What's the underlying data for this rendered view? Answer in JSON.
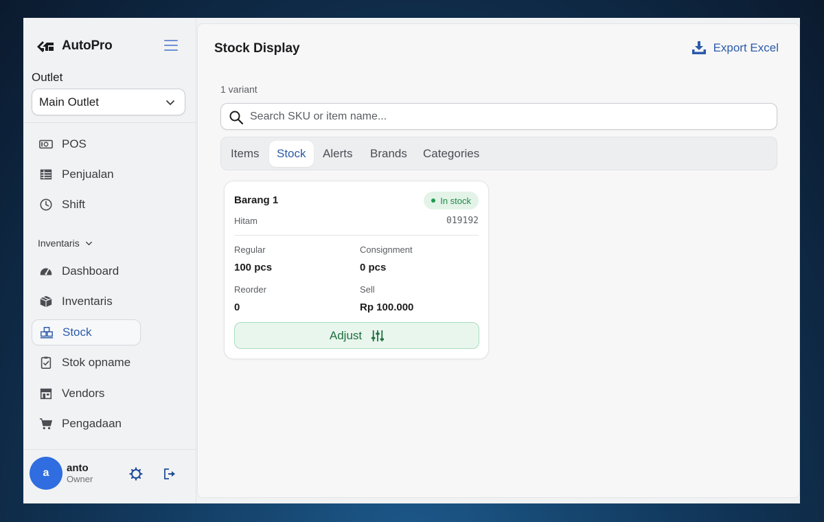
{
  "app": {
    "name": "AutoPro",
    "logo_icon": "autopro-logo-icon",
    "menu_icon": "hamburger-menu-icon"
  },
  "outlet": {
    "label": "Outlet",
    "selected": "Main Outlet"
  },
  "nav": {
    "top_items": [
      {
        "label": "POS",
        "icon": "cash-icon"
      },
      {
        "label": "Penjualan",
        "icon": "list-icon"
      },
      {
        "label": "Shift",
        "icon": "clock-icon"
      }
    ],
    "section_label": "Inventaris",
    "inventory_items": [
      {
        "label": "Dashboard",
        "icon": "gauge-icon"
      },
      {
        "label": "Inventaris",
        "icon": "box-icon"
      },
      {
        "label": "Stock",
        "icon": "stock-icon",
        "active": true
      },
      {
        "label": "Stok opname",
        "icon": "clipboard-check-icon"
      },
      {
        "label": "Vendors",
        "icon": "store-icon"
      },
      {
        "label": "Pengadaan",
        "icon": "cart-icon"
      }
    ]
  },
  "user": {
    "initial": "a",
    "name": "anto",
    "role": "Owner",
    "settings_icon": "gear-icon",
    "logout_icon": "logout-icon"
  },
  "page": {
    "title": "Stock Display",
    "export_label": "Export Excel",
    "variant_count": "1 variant",
    "search_placeholder": "Search SKU or item name..."
  },
  "tabs": [
    {
      "label": "Items"
    },
    {
      "label": "Stock",
      "active": true
    },
    {
      "label": "Alerts"
    },
    {
      "label": "Brands"
    },
    {
      "label": "Categories"
    }
  ],
  "card": {
    "name": "Barang 1",
    "status": "In stock",
    "variant": "Hitam",
    "sku": "019192",
    "regular_label": "Regular",
    "regular_value": "100 pcs",
    "consignment_label": "Consignment",
    "consignment_value": "0 pcs",
    "reorder_label": "Reorder",
    "reorder_value": "0",
    "sell_label": "Sell",
    "sell_value": "Rp 100.000",
    "adjust_label": "Adjust"
  },
  "colors": {
    "accent": "#2b5aa8",
    "success": "#1e8a47",
    "avatar": "#2f6de0"
  }
}
